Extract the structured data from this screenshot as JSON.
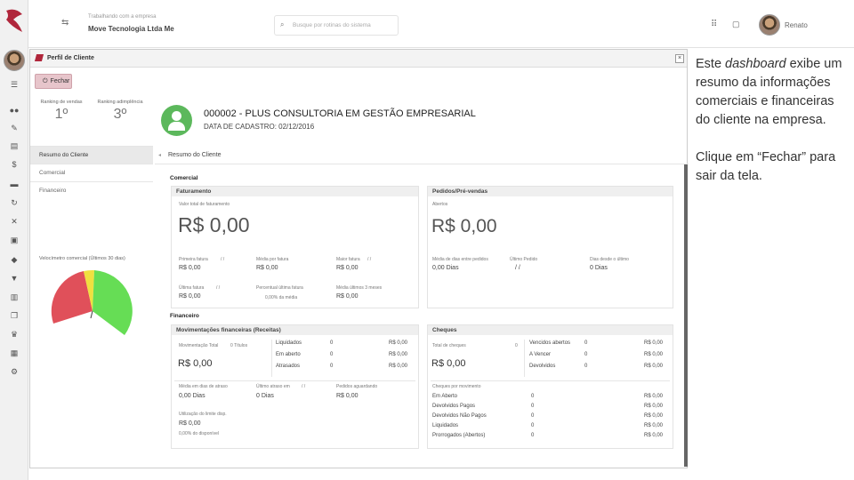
{
  "topbar": {
    "company_label": "Trabalhando com a empresa",
    "company_name": "Move Tecnologia Ltda Me",
    "search_placeholder": "Busque por rotinas do sistema",
    "user_name": "Renato"
  },
  "modal": {
    "title": "Perfil de Cliente",
    "close_label": "Fechar"
  },
  "left": {
    "rank_sales_label": "Ranking de vendas",
    "rank_sales_value": "1º",
    "rank_default_label": "Ranking adimplência",
    "rank_default_value": "3º",
    "nav": [
      "Resumo do Cliente",
      "Comercial",
      "Financeiro"
    ],
    "gauge_title": "Velocímetro comercial (Últimos 30 dias)"
  },
  "client": {
    "name": "000002 - PLUS CONSULTORIA EM GESTÃO EMPRESARIAL",
    "date": "DATA DE CADASTRO: 02/12/2016"
  },
  "screen_title": "Resumo do Cliente",
  "comercial": {
    "section": "Comercial",
    "faturamento": {
      "title": "Faturamento",
      "total_label": "Valor total de faturamento",
      "total_value": "R$ 0,00",
      "first_label": "Primeira fatura",
      "first_date": "/ /",
      "first_value": "R$ 0,00",
      "avg_label": "Média por fatura",
      "avg_value": "R$ 0,00",
      "max_label": "Maior fatura",
      "max_date": "/ /",
      "max_value": "R$ 0,00",
      "last_label": "Última fatura",
      "last_date": "/ /",
      "last_value": "R$ 0,00",
      "pct_label": "Percentual última fatura",
      "pct_value": "0,00% da média",
      "avg3_label": "Média últimos 3 meses",
      "avg3_value": "R$ 0,00"
    },
    "pedidos": {
      "title": "Pedidos/Pré-vendas",
      "open_label": "Abertos",
      "open_value": "R$ 0,00",
      "avgdays_label": "Média de dias entre pedidos",
      "avgdays_value": "0,00 Dias",
      "last_label": "Último Pedido",
      "last_value": "/ /",
      "since_label": "Dias desde o último",
      "since_value": "0 Dias"
    }
  },
  "financeiro": {
    "section": "Financeiro",
    "mov": {
      "title": "Movimentações financeiras (Receitas)",
      "total_label": "Movimentação Total",
      "total_count": "0 Títulos",
      "total_value": "R$ 0,00",
      "rows": [
        {
          "label": "Liquidados",
          "count": "0",
          "value": "R$ 0,00"
        },
        {
          "label": "Em aberto",
          "count": "0",
          "value": "R$ 0,00"
        },
        {
          "label": "Atrasados",
          "count": "0",
          "value": "R$ 0,00"
        }
      ],
      "avgdelay_label": "Média em dias de atraso",
      "avgdelay_value": "0,00 Dias",
      "lastdelay_label": "Último atraso em",
      "lastdelay_date": "/ /",
      "lastdelay_value": "0 Dias",
      "overdue_label": "Pedidos aguardando",
      "overdue_value": "R$ 0,00",
      "limit_label": "Utilização do limite disp.",
      "limit_value": "R$ 0,00",
      "limit_pct": "0,00% do disponível"
    },
    "cheques": {
      "title": "Cheques",
      "total_label": "Total de cheques",
      "total_count": "0",
      "total_value": "R$ 0,00",
      "rows": [
        {
          "label": "Vencidos abertos",
          "count": "0",
          "value": "R$ 0,00"
        },
        {
          "label": "A Vencer",
          "count": "0",
          "value": "R$ 0,00"
        },
        {
          "label": "Devolvidos",
          "count": "0",
          "value": "R$ 0,00"
        }
      ],
      "mov_label": "Cheques por movimento",
      "mov_rows": [
        {
          "label": "Em Aberto",
          "count": "0",
          "value": "R$ 0,00"
        },
        {
          "label": "Devolvidos Pagos",
          "count": "0",
          "value": "R$ 0,00"
        },
        {
          "label": "Devolvidos Não Pagos",
          "count": "0",
          "value": "R$ 0,00"
        },
        {
          "label": "Liquidados",
          "count": "0",
          "value": "R$ 0,00"
        },
        {
          "label": "Prorrogados (Abertos)",
          "count": "0",
          "value": "R$ 0,00"
        }
      ]
    }
  },
  "callout": {
    "p1_a": "Este ",
    "p1_em": "dashboard",
    "p1_b": " exibe um resumo da informações comerciais e financeiras do cliente na empresa.",
    "p2": "Clique em “Fechar” para sair da tela."
  }
}
